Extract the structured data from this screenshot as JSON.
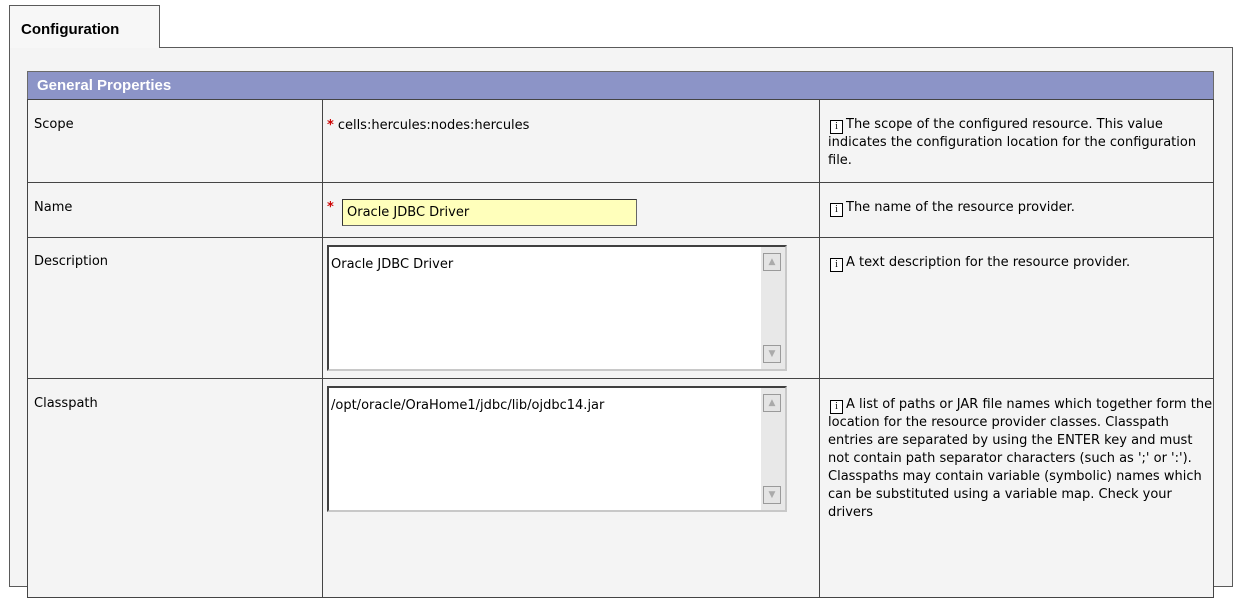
{
  "tab": {
    "label": "Configuration"
  },
  "section": {
    "title": "General Properties"
  },
  "rows": {
    "scope": {
      "label": "Scope",
      "value": "cells:hercules:nodes:hercules",
      "description": "The scope of the configured resource. This value indicates the configuration location for the configuration file."
    },
    "name": {
      "label": "Name",
      "value": "Oracle JDBC Driver",
      "description": "The name of the resource provider."
    },
    "description": {
      "label": "Description",
      "value": "Oracle JDBC Driver",
      "description": "A text description for the resource provider."
    },
    "classpath": {
      "label": "Classpath",
      "value": "/opt/oracle/OraHome1/jdbc/lib/ojdbc14.jar",
      "description": "A list of paths or JAR file names which together form the location for the resource provider classes. Classpath entries are separated by using the ENTER key and must not contain path separator characters (such as ';' or ':'). Classpaths may contain variable (symbolic) names which can be substituted using a variable map. Check your drivers"
    }
  },
  "required_marker": "*",
  "info_icon_glyph": "i",
  "scroll_up_glyph": "▲",
  "scroll_down_glyph": "▼",
  "colors": {
    "section_header": "#8c94c7",
    "required_field": "#ffffbb",
    "required_marker": "#cc0000"
  }
}
